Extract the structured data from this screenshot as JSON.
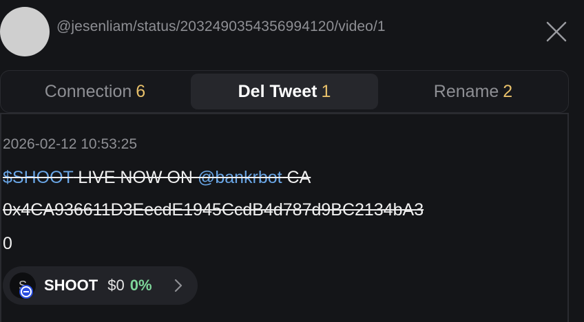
{
  "header": {
    "handle": "@jesenliam/status/2032490354356994120/video/1"
  },
  "tabs": [
    {
      "label": "Connection",
      "count": "6",
      "active": false
    },
    {
      "label": "Del Tweet",
      "count": "1",
      "active": true
    },
    {
      "label": "Rename",
      "count": "2",
      "active": false
    }
  ],
  "tweet": {
    "timestamp": "2026-02-12 10:53:25",
    "cashtag": "$SHOOT",
    "text_part1": " LIVE NOW ON ",
    "mention": "@bankrbot",
    "text_part2": " CA",
    "contract": "0x4CA936611D3EecdE1945CcdB4d787d9BC2134bA3",
    "trailing": "0",
    "deleted": true
  },
  "token": {
    "avatar_letter": "S",
    "name": "SHOOT",
    "price": "$0",
    "change": "0%",
    "change_color": "#7ed69a"
  },
  "colors": {
    "background": "#141518",
    "accent_count": "#e8c06a",
    "link": "#6aa6e6"
  }
}
